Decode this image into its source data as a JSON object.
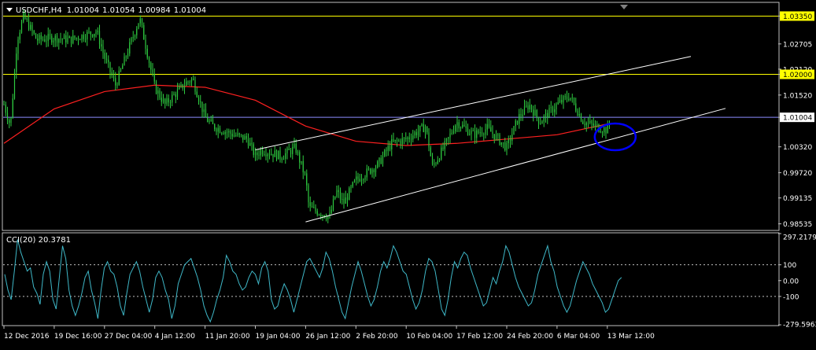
{
  "chart_data": [
    {
      "type": "candlestick",
      "symbol": "USDCHF",
      "timeframe": "H4",
      "header": "USDCHF,H4",
      "ohlc_current": {
        "open": "1.01004",
        "high": "1.01054",
        "low": "1.00984",
        "close": "1.01004"
      },
      "ylim": [
        0.984,
        1.0365
      ],
      "y_ticks": [
        "1.03350",
        "1.02705",
        "1.02120",
        "1.02000",
        "1.01520",
        "1.01004",
        "1.00320",
        "0.99720",
        "0.99135",
        "0.98535"
      ],
      "x_ticks": [
        "12 Dec 2016",
        "19 Dec 16:00",
        "27 Dec 04:00",
        "4 Jan 12:00",
        "11 Jan 20:00",
        "19 Jan 04:00",
        "26 Jan 12:00",
        "2 Feb 20:00",
        "10 Feb 04:00",
        "17 Feb 12:00",
        "24 Feb 20:00",
        "6 Mar 04:00",
        "13 Mar 12:00"
      ],
      "horizontal_levels": [
        {
          "value": 1.0335,
          "label": "1.03350",
          "color": "#ffff00"
        },
        {
          "value": 1.02,
          "label": "1.02000",
          "color": "#ffff00"
        },
        {
          "value": 1.01004,
          "label": "1.01004",
          "color": "#8c8cff"
        }
      ],
      "price_path": [
        {
          "x": "12 Dec 2016",
          "y": 1.013
        },
        {
          "x": "13 Dec",
          "y": 1.008
        },
        {
          "x": "14 Dec",
          "y": 1.028
        },
        {
          "x": "15 Dec",
          "y": 1.0335
        },
        {
          "x": "17 Dec",
          "y": 1.028
        },
        {
          "x": "19 Dec 16:00",
          "y": 1.0285
        },
        {
          "x": "22 Dec",
          "y": 1.028
        },
        {
          "x": "26 Dec",
          "y": 1.03
        },
        {
          "x": "27 Dec 04:00",
          "y": 1.024
        },
        {
          "x": "29 Dec",
          "y": 1.0175
        },
        {
          "x": "2 Jan",
          "y": 1.033
        },
        {
          "x": "4 Jan 12:00",
          "y": 1.017
        },
        {
          "x": "6 Jan",
          "y": 1.013
        },
        {
          "x": "9 Jan",
          "y": 1.018
        },
        {
          "x": "10 Jan",
          "y": 1.019
        },
        {
          "x": "11 Jan 20:00",
          "y": 1.01
        },
        {
          "x": "13 Jan",
          "y": 1.008
        },
        {
          "x": "16 Jan",
          "y": 1.006
        },
        {
          "x": "18 Jan",
          "y": 1.005
        },
        {
          "x": "19 Jan 04:00",
          "y": 1.001
        },
        {
          "x": "20 Jan",
          "y": 1.0025
        },
        {
          "x": "23 Jan",
          "y": 1.001
        },
        {
          "x": "25 Jan",
          "y": 1.003
        },
        {
          "x": "26 Jan 12:00",
          "y": 0.996
        },
        {
          "x": "27 Jan",
          "y": 0.989
        },
        {
          "x": "30 Jan",
          "y": 0.987
        },
        {
          "x": "31 Jan",
          "y": 0.993
        },
        {
          "x": "1 Feb",
          "y": 0.99
        },
        {
          "x": "2 Feb 20:00",
          "y": 0.9955
        },
        {
          "x": "6 Feb",
          "y": 0.999
        },
        {
          "x": "8 Feb",
          "y": 1.004
        },
        {
          "x": "10 Feb 04:00",
          "y": 1.005
        },
        {
          "x": "13 Feb",
          "y": 1.008
        },
        {
          "x": "14 Feb",
          "y": 0.9985
        },
        {
          "x": "16 Feb",
          "y": 1.004
        },
        {
          "x": "17 Feb 12:00",
          "y": 1.009
        },
        {
          "x": "20 Feb",
          "y": 1.006
        },
        {
          "x": "22 Feb",
          "y": 1.0075
        },
        {
          "x": "24 Feb 20:00",
          "y": 1.003
        },
        {
          "x": "27 Feb",
          "y": 1.01
        },
        {
          "x": "1 Mar",
          "y": 1.013
        },
        {
          "x": "3 Mar",
          "y": 1.009
        },
        {
          "x": "6 Mar 04:00",
          "y": 1.013
        },
        {
          "x": "8 Mar",
          "y": 1.015
        },
        {
          "x": "10 Mar",
          "y": 1.009
        },
        {
          "x": "13 Mar 12:00",
          "y": 1.007
        },
        {
          "x": "14 Mar",
          "y": 1.01
        }
      ],
      "moving_average": {
        "color": "#ff2020",
        "points": [
          {
            "x": "12 Dec 2016",
            "y": 1.004
          },
          {
            "x": "19 Dec 16:00",
            "y": 1.012
          },
          {
            "x": "27 Dec 04:00",
            "y": 1.016
          },
          {
            "x": "4 Jan 12:00",
            "y": 1.0175
          },
          {
            "x": "11 Jan 20:00",
            "y": 1.017
          },
          {
            "x": "19 Jan 04:00",
            "y": 1.014
          },
          {
            "x": "26 Jan 12:00",
            "y": 1.008
          },
          {
            "x": "2 Feb 20:00",
            "y": 1.0045
          },
          {
            "x": "10 Feb 04:00",
            "y": 1.0035
          },
          {
            "x": "17 Feb 12:00",
            "y": 1.004
          },
          {
            "x": "24 Feb 20:00",
            "y": 1.005
          },
          {
            "x": "6 Mar 04:00",
            "y": 1.006
          },
          {
            "x": "13 Mar 12:00",
            "y": 1.0085
          }
        ]
      },
      "channel": {
        "color": "#ffffff",
        "lower": [
          {
            "x": "26 Jan 12:00",
            "y": 0.9858
          },
          {
            "x": "13 Mar 12:00",
            "y": 1.0047
          }
        ],
        "upper": [
          {
            "x": "19 Jan 04:00",
            "y": 1.0025
          },
          {
            "x": "13 Mar 12:00",
            "y": 1.02
          }
        ]
      },
      "highlight_ellipse": {
        "x": "13 Mar 12:00",
        "y": 1.0055,
        "color": "#0000ff"
      },
      "candle_color": "#2ecc40"
    },
    {
      "type": "line",
      "title": "CCI(20) 20.3781",
      "name": "CCI",
      "period": 20,
      "current_value": 20.3781,
      "ylim": [
        -279.5963,
        297.2179
      ],
      "y_ticks": [
        "297.2179",
        "100",
        "0.00",
        "-100",
        "-279.5963"
      ],
      "levels": [
        100,
        -100
      ],
      "series_color": "#3fb8c8",
      "values": [
        40,
        -60,
        -120,
        60,
        260,
        180,
        120,
        60,
        80,
        -40,
        -80,
        -150,
        40,
        120,
        60,
        -120,
        -180,
        20,
        220,
        140,
        -60,
        -160,
        -220,
        -160,
        -80,
        20,
        60,
        -60,
        -140,
        -240,
        -60,
        80,
        120,
        60,
        40,
        -40,
        -160,
        -220,
        -80,
        40,
        80,
        120,
        60,
        -40,
        -120,
        -200,
        -120,
        20,
        60,
        20,
        -60,
        -120,
        -240,
        -160,
        -20,
        40,
        100,
        120,
        140,
        80,
        20,
        -60,
        -160,
        -220,
        -260,
        -200,
        -120,
        -60,
        20,
        160,
        120,
        60,
        40,
        -20,
        -60,
        -40,
        20,
        60,
        40,
        -20,
        80,
        120,
        60,
        -120,
        -180,
        -160,
        -80,
        -20,
        -60,
        -120,
        -200,
        -120,
        -40,
        40,
        120,
        140,
        100,
        60,
        20,
        80,
        180,
        140,
        60,
        -40,
        -120,
        -200,
        -240,
        -140,
        -40,
        40,
        120,
        60,
        -20,
        -100,
        -160,
        -120,
        -40,
        60,
        120,
        80,
        140,
        220,
        180,
        120,
        60,
        40,
        -40,
        -120,
        -180,
        -140,
        -60,
        60,
        140,
        120,
        60,
        -60,
        -180,
        -220,
        -120,
        20,
        120,
        80,
        140,
        180,
        160,
        80,
        20,
        -40,
        -100,
        -160,
        -140,
        -60,
        20,
        -20,
        60,
        120,
        220,
        180,
        100,
        20,
        -40,
        -80,
        -120,
        -160,
        -140,
        -60,
        40,
        100,
        160,
        220,
        120,
        60,
        -40,
        -100,
        -160,
        -200,
        -160,
        -80,
        0,
        60,
        120,
        80,
        40,
        -20,
        -60,
        -100,
        -140,
        -200,
        -180,
        -120,
        -60,
        0,
        20
      ]
    }
  ]
}
